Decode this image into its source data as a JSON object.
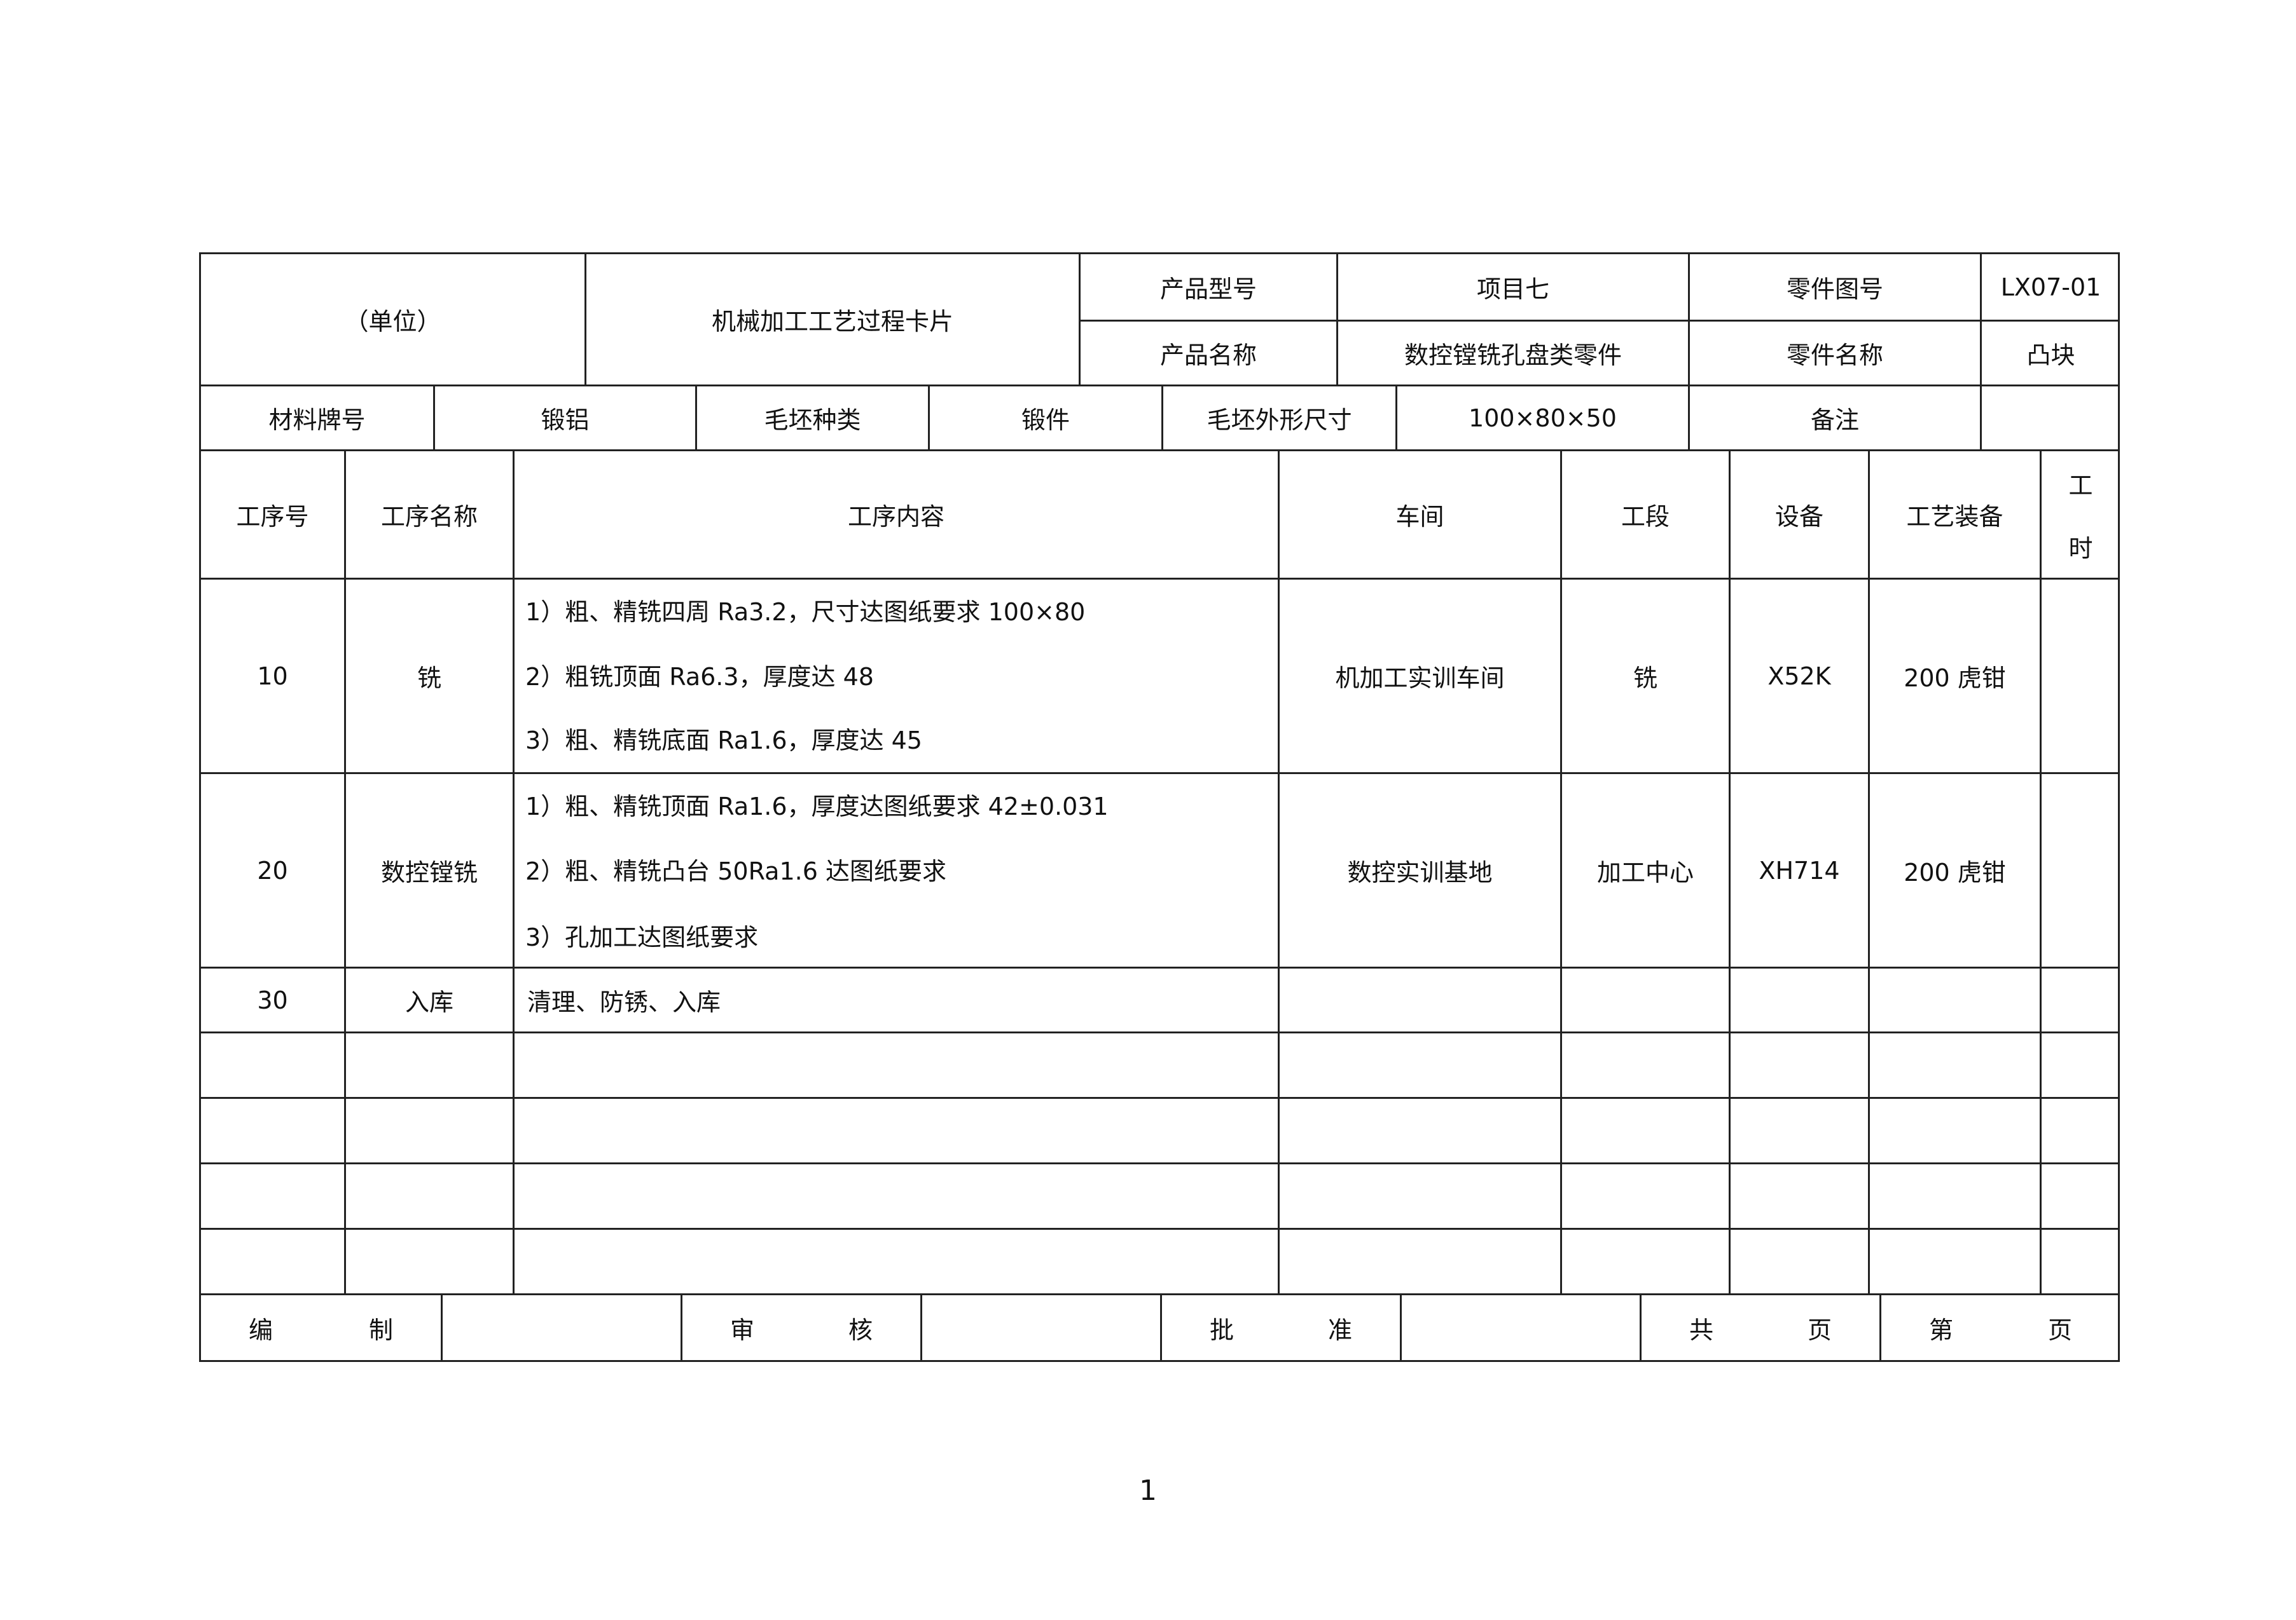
{
  "header": {
    "unit": "（单位）",
    "card_title": "机械加工工艺过程卡片",
    "product_model_label": "产品型号",
    "product_model": "项目七",
    "part_drawing_no_label": "零件图号",
    "part_drawing_no": "LX07-01",
    "product_name_label": "产品名称",
    "product_name": "数控镗铣孔盘类零件",
    "part_name_label": "零件名称",
    "part_name": "凸块"
  },
  "material": {
    "grade_label": "材料牌号",
    "grade": "锻铝",
    "blank_type_label": "毛坯种类",
    "blank_type": "锻件",
    "blank_size_label": "毛坯外形尺寸",
    "blank_size": "100×80×50",
    "remark_label": "备注",
    "remark": ""
  },
  "columns": {
    "op_no": "工序号",
    "op_name": "工序名称",
    "op_content": "工序内容",
    "workshop": "车间",
    "section": "工段",
    "equipment": "设备",
    "tooling": "工艺装备",
    "time_1": "工",
    "time_2": "时"
  },
  "operations": [
    {
      "no": "10",
      "name": "铣",
      "content": [
        "1）粗、精铣四周   Ra3.2，尺寸达图纸要求   100×80",
        "2）粗铣顶面   Ra6.3，厚度达  48",
        "3）粗、精铣底面   Ra1.6，厚度达  45"
      ],
      "workshop": "机加工实训车间",
      "section": "铣",
      "equipment": "X52K",
      "tooling": "200 虎钳"
    },
    {
      "no": "20",
      "name": "数控镗铣",
      "content": [
        "1）粗、精铣顶面   Ra1.6，厚度达图纸要求   42±0.031",
        "2）粗、精铣凸台   50Ra1.6 达图纸要求",
        "3）孔加工达图纸要求"
      ],
      "workshop": "数控实训基地",
      "section": "加工中心",
      "equipment": "XH714",
      "tooling": "200 虎钳"
    },
    {
      "no": "30",
      "name": "入库",
      "content": [
        "清理、防锈、入库"
      ]
    }
  ],
  "footer": {
    "compiled_1": "编",
    "compiled_2": "制",
    "review_1": "审",
    "review_2": "核",
    "approve_1": "批",
    "approve_2": "准",
    "total_1": "共",
    "total_2": "页",
    "page_1": "第",
    "page_2": "页"
  },
  "page_number": "1"
}
